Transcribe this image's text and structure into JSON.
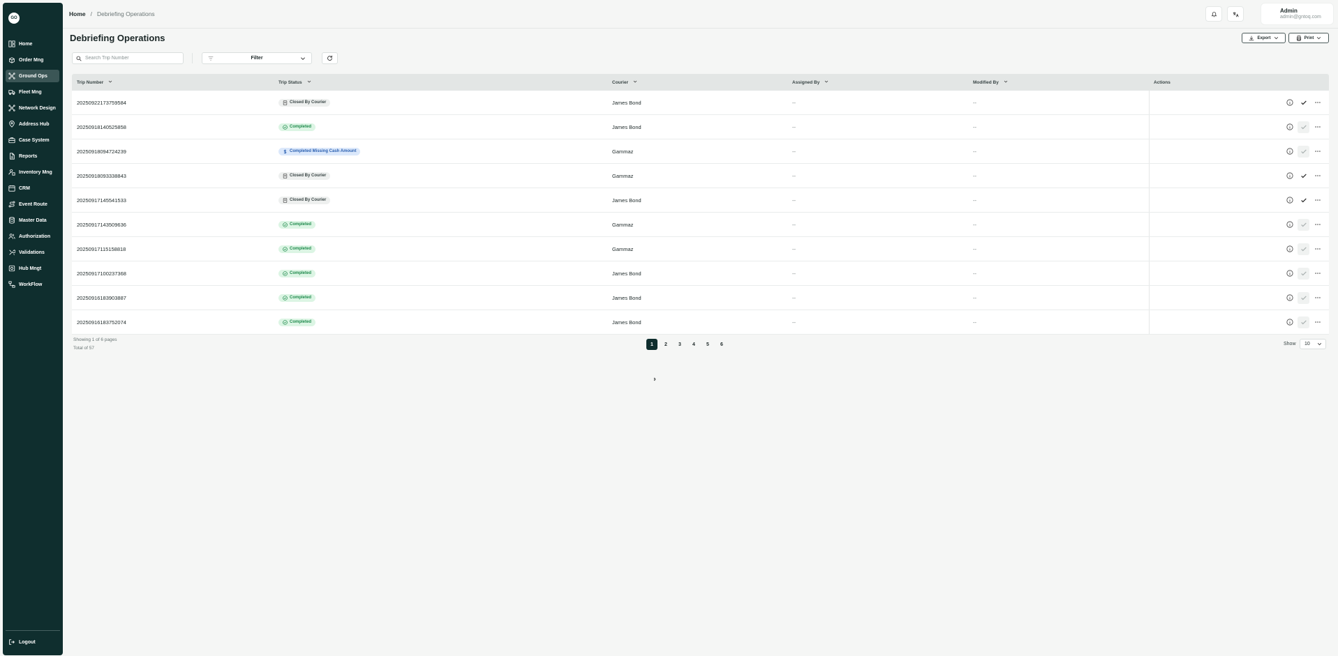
{
  "app": {
    "logo_text": "GO",
    "accent_color": "#0f2e2e",
    "sidebar_active_color": "#3b5656"
  },
  "sidebar": {
    "items": [
      {
        "label": "Home",
        "icon": "dashboard-icon"
      },
      {
        "label": "Order Mng",
        "icon": "box-icon"
      },
      {
        "label": "Ground Ops",
        "icon": "network-icon",
        "active": true
      },
      {
        "label": "Fleet Mng",
        "icon": "truck-icon"
      },
      {
        "label": "Network Design",
        "icon": "network-icon"
      },
      {
        "label": "Address Hub",
        "icon": "pin-icon"
      },
      {
        "label": "Case System",
        "icon": "briefcase-icon"
      },
      {
        "label": "Reports",
        "icon": "document-icon"
      },
      {
        "label": "Inventory Mng",
        "icon": "user-box-icon"
      },
      {
        "label": "CRM",
        "icon": "calendar-icon"
      },
      {
        "label": "Event Route",
        "icon": "route-icon"
      },
      {
        "label": "Master Data",
        "icon": "database-icon"
      },
      {
        "label": "Authorization",
        "icon": "users-icon"
      },
      {
        "label": "Validations",
        "icon": "tools-icon"
      },
      {
        "label": "Hub Mngt",
        "icon": "hub-icon"
      },
      {
        "label": "WorkFlow",
        "icon": "workflow-icon"
      }
    ],
    "logout_label": "Logout"
  },
  "header": {
    "breadcrumb_home": "Home",
    "breadcrumb_sep": "/",
    "breadcrumb_current": "Debriefing Operations",
    "user_name": "Admin",
    "user_email": "admin@gntoq.com"
  },
  "main": {
    "title": "Debriefing Operations",
    "export_label": "Export",
    "print_label": "Print",
    "search_placeholder": "Search Trip Number",
    "filter_label": "Filter"
  },
  "table": {
    "columns": [
      "Trip Number",
      "Trip Status",
      "Courier",
      "Assigned By",
      "Modified By",
      "Actions"
    ],
    "rows": [
      {
        "trip": "20250922173759584",
        "status": "Closed By Courier",
        "status_type": "grey",
        "courier": "James Bond",
        "assigned": "--",
        "modified": "--",
        "approve_enabled": true
      },
      {
        "trip": "20250918140525858",
        "status": "Completed",
        "status_type": "green",
        "courier": "James Bond",
        "assigned": "--",
        "modified": "--",
        "approve_enabled": false
      },
      {
        "trip": "20250918094724239",
        "status": "Completed Missing Cash Amount",
        "status_type": "blue",
        "courier": "Gammaz",
        "assigned": "--",
        "modified": "--",
        "approve_enabled": false
      },
      {
        "trip": "20250918093338843",
        "status": "Closed By Courier",
        "status_type": "grey",
        "courier": "Gammaz",
        "assigned": "--",
        "modified": "--",
        "approve_enabled": true
      },
      {
        "trip": "20250917145541533",
        "status": "Closed By Courier",
        "status_type": "grey",
        "courier": "James Bond",
        "assigned": "--",
        "modified": "--",
        "approve_enabled": true
      },
      {
        "trip": "20250917143509636",
        "status": "Completed",
        "status_type": "green",
        "courier": "Gammaz",
        "assigned": "--",
        "modified": "--",
        "approve_enabled": false
      },
      {
        "trip": "20250917115158818",
        "status": "Completed",
        "status_type": "green",
        "courier": "Gammaz",
        "assigned": "--",
        "modified": "--",
        "approve_enabled": false
      },
      {
        "trip": "20250917100237368",
        "status": "Completed",
        "status_type": "green",
        "courier": "James Bond",
        "assigned": "--",
        "modified": "--",
        "approve_enabled": false
      },
      {
        "trip": "20250916183903887",
        "status": "Completed",
        "status_type": "green",
        "courier": "James Bond",
        "assigned": "--",
        "modified": "--",
        "approve_enabled": false
      },
      {
        "trip": "20250916183752074",
        "status": "Completed",
        "status_type": "green",
        "courier": "James Bond",
        "assigned": "--",
        "modified": "--",
        "approve_enabled": false
      }
    ]
  },
  "footer": {
    "showing": "Showing 1 of 6 pages",
    "total": "Total of 57",
    "pages": [
      "1",
      "2",
      "3",
      "4",
      "5",
      "6"
    ],
    "current_page": "1",
    "show_label": "Show",
    "page_size": "10"
  }
}
